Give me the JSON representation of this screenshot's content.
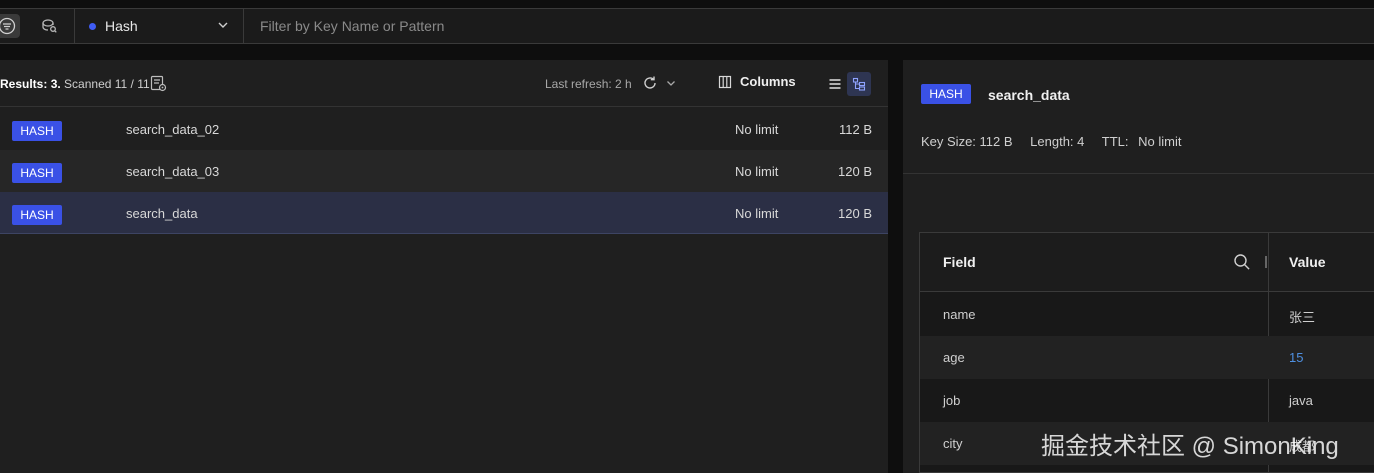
{
  "filter_bar": {
    "view_toggles": [
      {
        "icon": "filter-list-icon",
        "active": true
      },
      {
        "icon": "search-index-icon",
        "active": false
      }
    ],
    "type_select": {
      "value": "Hash",
      "dot_color": "#3f5cf5"
    },
    "filter": {
      "placeholder": "Filter by Key Name or Pattern",
      "value": ""
    }
  },
  "key_list": {
    "results_label": "Results:",
    "results_count": "3.",
    "scanned_text": "Scanned 11 / 11",
    "last_refresh": "Last refresh: 2 h",
    "columns_label": "Columns",
    "rows": [
      {
        "type": "HASH",
        "name": "search_data_02",
        "ttl": "No limit",
        "size": "112 B"
      },
      {
        "type": "HASH",
        "name": "search_data_03",
        "ttl": "No limit",
        "size": "120 B"
      },
      {
        "type": "HASH",
        "name": "search_data",
        "ttl": "No limit",
        "size": "120 B"
      }
    ]
  },
  "key_details": {
    "type": "HASH",
    "name": "search_data",
    "key_size": "Key Size: 112 B",
    "length": "Length: 4",
    "ttl_label": "TTL:",
    "ttl_value": "No limit",
    "table": {
      "field_header": "Field",
      "value_header": "Value",
      "rows": [
        {
          "field": "name",
          "value": "张三"
        },
        {
          "field": "age",
          "value": "15"
        },
        {
          "field": "job",
          "value": "java"
        },
        {
          "field": "city",
          "value": "成都"
        }
      ]
    }
  },
  "watermark": "掘金技术社区 @ SimonKing",
  "colors": {
    "accent": "#3a51e6",
    "number_value": "#4e8fe0",
    "selected_row": "#2b2f45"
  }
}
